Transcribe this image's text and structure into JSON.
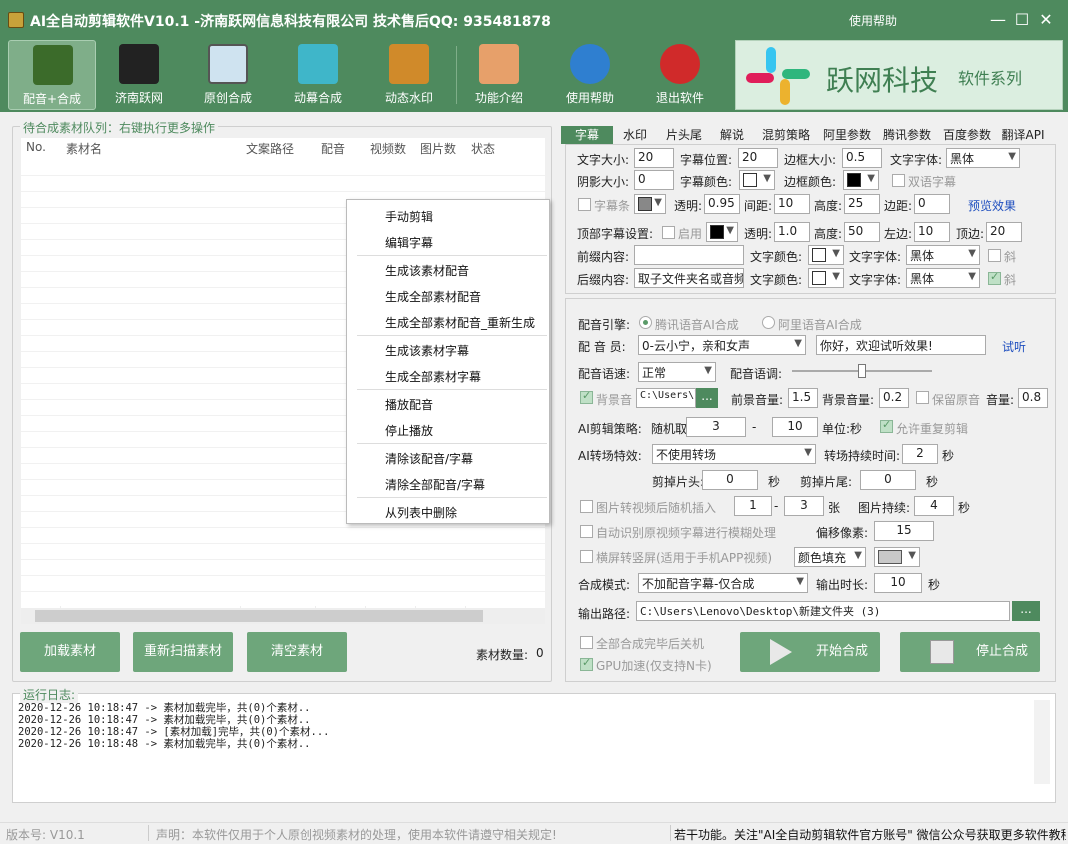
{
  "window": {
    "title": "AI全自动剪辑软件V10.1 -济南跃网信息科技有限公司 技术售后QQ: 935481878",
    "help": "使用帮助",
    "minimize": "—",
    "maximize": "☐",
    "close": "✕"
  },
  "toolbar": {
    "items": [
      {
        "label": "配音+合成"
      },
      {
        "label": "济南跃网"
      },
      {
        "label": "原创合成"
      },
      {
        "label": "动幕合成"
      },
      {
        "label": "动态水印"
      },
      {
        "label": "功能介绍"
      },
      {
        "label": "使用帮助"
      },
      {
        "label": "退出软件"
      }
    ],
    "logo": {
      "name": "跃网科技",
      "sub": "软件系列"
    }
  },
  "queue": {
    "legend": "待合成素材队列：右键执行更多操作",
    "columns": [
      "No.",
      "素材名",
      "文案路径",
      "配音",
      "视频数",
      "图片数",
      "状态"
    ],
    "buttons": {
      "load": "加载素材",
      "rescan": "重新扫描素材",
      "clear": "清空素材"
    },
    "count_label": "素材数量:",
    "count": "0"
  },
  "context_menu": {
    "items": [
      "手动剪辑",
      "编辑字幕",
      "生成该素材配音",
      "生成全部素材配音",
      "生成全部素材配音_重新生成",
      "生成该素材字幕",
      "生成全部素材字幕",
      "播放配音",
      "停止播放",
      "清除该配音/字幕",
      "清除全部配音/字幕",
      "从列表中删除"
    ]
  },
  "tabs": [
    "字幕",
    "水印",
    "片头尾",
    "解说",
    "混剪策略",
    "阿里参数",
    "腾讯参数",
    "百度参数",
    "翻译API"
  ],
  "subtitle": {
    "font_size_label": "文字大小:",
    "font_size": "20",
    "pos_label": "字幕位置:",
    "pos": "20",
    "border_size_label": "边框大小:",
    "border_size": "0.5",
    "font_label": "文字字体:",
    "font": "黑体",
    "shadow_label": "阴影大小:",
    "shadow": "0",
    "color_label": "字幕颜色:",
    "border_color_label": "边框颜色:",
    "dual_label": "双语字幕",
    "bar_label": "字幕条",
    "alpha_label": "透明:",
    "alpha": "0.95",
    "spacing_label": "间距:",
    "spacing": "10",
    "height_label": "高度:",
    "height": "25",
    "margin_label": "边距:",
    "margin": "0",
    "preview": "预览效果",
    "top_label": "顶部字幕设置:",
    "enable_label": "启用",
    "top_alpha": "1.0",
    "top_height": "50",
    "left_label": "左边:",
    "left": "10",
    "top_margin_label": "顶边:",
    "top_margin": "20",
    "prefix_label": "前缀内容:",
    "prefix": "",
    "text_color_label": "文字颜色:",
    "text_font_label": "文字字体:",
    "italic": "斜",
    "suffix_label": "后缀内容:",
    "suffix": "取子文件夹名或音频"
  },
  "voice": {
    "engine_label": "配音引擎:",
    "engine_tencent": "腾讯语音AI合成",
    "engine_ali": "阿里语音AI合成",
    "voice_label": "配 音 员:",
    "voice": "0-云小宁，亲和女声",
    "sample": "你好，欢迎试听效果!",
    "try": "试听",
    "speed_label": "配音语速:",
    "speed": "正常",
    "tone_label": "配音语调:",
    "tone_level": 0.5,
    "bgm_label": "背景音",
    "bgm_path": "C:\\Users\\l",
    "fg_vol_label": "前景音量:",
    "fg_vol": "1.5",
    "bg_vol_label": "背景音量:",
    "bg_vol": "0.2",
    "keep_label": "保留原音",
    "vol_label": "音量:",
    "vol": "0.8",
    "strategy_label": "AI剪辑策略:",
    "random_label": "随机取:",
    "random_from": "3",
    "random_to": "10",
    "dash": "-",
    "unit_label": "单位:秒",
    "allow_repeat": "允许重复剪辑",
    "trans_label": "AI转场特效:",
    "trans": "不使用转场",
    "trans_dur_label": "转场持续时间:",
    "trans_dur": "2",
    "sec": "秒",
    "cut_head_label": "剪掉片头:",
    "cut_head": "0",
    "cut_tail_label": "剪掉片尾:",
    "cut_tail": "0",
    "img_insert_label": "图片转视频后随机插入",
    "img_from": "1",
    "img_to": "3",
    "zhang": "张",
    "img_dur_label": "图片持续:",
    "img_dur": "4",
    "blur_label": "自动识别原视频字幕进行模糊处理",
    "offset_label": "偏移像素:",
    "offset": "15",
    "portrait_label": "横屏转竖屏(适用于手机APP视频)",
    "fill": "颜色填充",
    "mode_label": "合成模式:",
    "mode": "不加配音字幕-仅合成",
    "out_dur_label": "输出时长:",
    "out_dur": "10",
    "out_path_label": "输出路径:",
    "out_path": "C:\\Users\\Lenovo\\Desktop\\新建文件夹 (3)",
    "shutdown_label": "全部合成完毕后关机",
    "gpu_label": "GPU加速(仅支持N卡)",
    "start": "开始合成",
    "stop": "停止合成",
    "more": "..."
  },
  "log": {
    "legend": "运行日志:",
    "lines": [
      "2020-12-26 10:18:47 -> 素材加载完毕，共(0)个素材..",
      "2020-12-26 10:18:47 -> 素材加载完毕，共(0)个素材..",
      "2020-12-26 10:18:47 -> [素材加载]完毕，共(0)个素材...",
      "2020-12-26 10:18:48 -> 素材加载完毕，共(0)个素材.."
    ]
  },
  "status": {
    "version": "版本号: V10.1",
    "notice": "声明：本软件仅用于个人原创视频素材的处理，使用本软件请遵守相关规定!",
    "marquee": "若干功能。关注\"AI全自动剪辑软件官方账号\" 微信公众号获取更多软件教程"
  }
}
